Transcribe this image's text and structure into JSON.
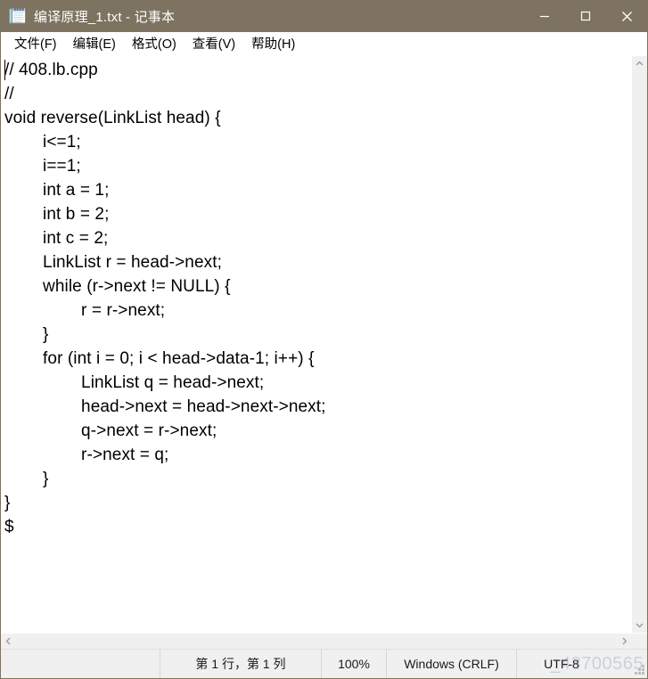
{
  "window": {
    "title": "编译原理_1.txt - 记事本",
    "icon": "notepad-icon",
    "titlebar_color": "#7d7360",
    "controls": {
      "minimize": "最小化",
      "maximize": "最大化",
      "close": "关闭"
    }
  },
  "menubar": {
    "items": [
      {
        "label": "文件(F)"
      },
      {
        "label": "编辑(E)"
      },
      {
        "label": "格式(O)"
      },
      {
        "label": "查看(V)"
      },
      {
        "label": "帮助(H)"
      }
    ]
  },
  "editor": {
    "content": "// 408.lb.cpp\n//\nvoid reverse(LinkList head) {\n        i<=1;\n        i==1;\n        int a = 1;\n        int b = 2;\n        int c = 2;\n        LinkList r = head->next;\n        while (r->next != NULL) {\n                r = r->next;\n        }\n        for (int i = 0; i < head->data-1; i++) {\n                LinkList q = head->next;\n                head->next = head->next->next;\n                q->next = r->next;\n                r->next = q;\n        }\n}\n$",
    "lines": [
      "// 408.lb.cpp",
      "//",
      "void reverse(LinkList head) {",
      "        i<=1;",
      "        i==1;",
      "        int a = 1;",
      "        int b = 2;",
      "        int c = 2;",
      "        LinkList r = head->next;",
      "        while (r->next != NULL) {",
      "                r = r->next;",
      "        }",
      "        for (int i = 0; i < head->data-1; i++) {",
      "                LinkList q = head->next;",
      "                head->next = head->next->next;",
      "                q->next = r->next;",
      "                r->next = q;",
      "        }",
      "}",
      "$"
    ]
  },
  "scrollbars": {
    "vertical": {
      "up_arrow": "▲",
      "down_arrow": "▼"
    },
    "horizontal": {
      "left_arrow": "◀",
      "right_arrow": "▶"
    }
  },
  "statusbar": {
    "position": "第 1 行，第 1 列",
    "zoom": "100%",
    "line_ending": "Windows (CRLF)",
    "encoding": "UTF-8"
  },
  "watermark": {
    "text": "_43700565"
  }
}
